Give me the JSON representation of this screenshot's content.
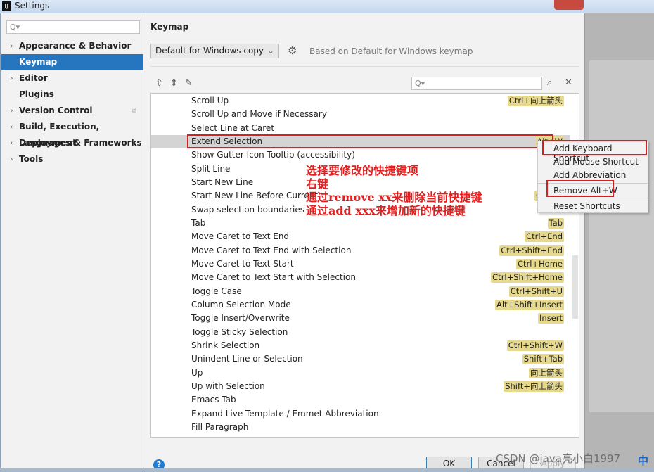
{
  "window": {
    "title": "Settings",
    "logo": "IJ"
  },
  "sidebar": {
    "search_placeholder": "Q▾",
    "items": [
      {
        "label": "Appearance & Behavior",
        "expandable": true
      },
      {
        "label": "Keymap",
        "expandable": false,
        "selected": true
      },
      {
        "label": "Editor",
        "expandable": true
      },
      {
        "label": "Plugins",
        "expandable": false
      },
      {
        "label": "Version Control",
        "expandable": true,
        "badge": "copy-icon"
      },
      {
        "label": "Build, Execution, Deployment",
        "expandable": true
      },
      {
        "label": "Languages & Frameworks",
        "expandable": true
      },
      {
        "label": "Tools",
        "expandable": true
      }
    ]
  },
  "main": {
    "heading": "Keymap",
    "keymap_select": "Default for Windows copy",
    "based_on": "Based on Default for Windows keymap",
    "filter_placeholder": "Q▾",
    "actions": [
      {
        "name": "Scroll Up",
        "key": "Ctrl+向上箭头"
      },
      {
        "name": "Scroll Up and Move if Necessary",
        "key": ""
      },
      {
        "name": "Select Line at Caret",
        "key": ""
      },
      {
        "name": "Extend Selection",
        "key": "Alt+W",
        "selected": true
      },
      {
        "name": "Show Gutter Icon Tooltip (accessibility)",
        "key": "Alt+S"
      },
      {
        "name": "Split Line",
        "key": "Ct"
      },
      {
        "name": "Start New Line",
        "key": "Shi"
      },
      {
        "name": "Start New Line Before Current",
        "key": "Ctrl+A"
      },
      {
        "name": "Swap selection boundaries",
        "key": ""
      },
      {
        "name": "Tab",
        "key": "Tab"
      },
      {
        "name": "Move Caret to Text End",
        "key": "Ctrl+End"
      },
      {
        "name": "Move Caret to Text End with Selection",
        "key": "Ctrl+Shift+End"
      },
      {
        "name": "Move Caret to Text Start",
        "key": "Ctrl+Home"
      },
      {
        "name": "Move Caret to Text Start with Selection",
        "key": "Ctrl+Shift+Home"
      },
      {
        "name": "Toggle Case",
        "key": "Ctrl+Shift+U"
      },
      {
        "name": "Column Selection Mode",
        "key": "Alt+Shift+Insert"
      },
      {
        "name": "Toggle Insert/Overwrite",
        "key": "Insert"
      },
      {
        "name": "Toggle Sticky Selection",
        "key": ""
      },
      {
        "name": "Shrink Selection",
        "key": "Ctrl+Shift+W"
      },
      {
        "name": "Unindent Line or Selection",
        "key": "Shift+Tab"
      },
      {
        "name": "Up",
        "key": "向上箭头"
      },
      {
        "name": "Up with Selection",
        "key": "Shift+向上箭头"
      },
      {
        "name": "Emacs Tab",
        "key": ""
      },
      {
        "name": "Expand Live Template / Emmet Abbreviation",
        "key": ""
      },
      {
        "name": "Fill Paragraph",
        "key": ""
      }
    ]
  },
  "context_menu": [
    "Add Keyboard Shortcut",
    "Add Mouse Shortcut",
    "Add Abbreviation",
    "Remove Alt+W",
    "Reset Shortcuts"
  ],
  "annotation": [
    "选择要修改的快捷键项",
    "右键",
    "通过remove xx来删除当前快捷键",
    "通过add xxx来增加新的快捷键"
  ],
  "buttons": {
    "ok": "OK",
    "cancel": "Cancel",
    "apply": "Apply",
    "help": "?"
  },
  "watermark": "CSDN @java亮小白1997",
  "ime": "中",
  "colors": {
    "selection": "#2675bf",
    "shortcut_badge": "#e6d98e",
    "annotation": "#e02020"
  }
}
